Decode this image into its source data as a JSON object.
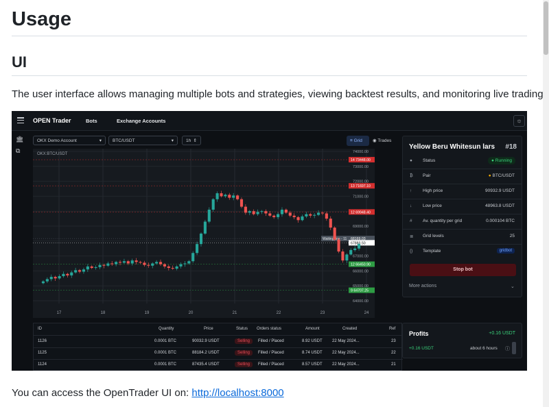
{
  "doc": {
    "heading": "Usage",
    "subheading": "UI",
    "paragraph": "The user interface allows managing multiple bots and strategies, viewing backtest results, and monitoring live trading.",
    "access_prefix": "You can access the OpenTrader UI on: ",
    "access_link": "http://localhost:8000"
  },
  "app": {
    "brand": "OPEN Trader",
    "nav": [
      "Bots",
      "Exchange Accounts"
    ],
    "theme_icon": "sun-icon",
    "toolbar": {
      "account": "OKX Demo Account",
      "pair": "BTC/USDT",
      "timeframe": "1h",
      "view_grid": "Grid",
      "view_trades": "Trades"
    },
    "chart_symbol": "OKX:BTC/USDT",
    "bot": {
      "name": "Yellow Beru Whitesun lars",
      "id": "#18",
      "rows": [
        {
          "icon": "status-icon",
          "label": "Status",
          "value": "Running"
        },
        {
          "icon": "pair-icon",
          "label": "Pair",
          "value": "BTC/USDT"
        },
        {
          "icon": "arrow-up-icon",
          "label": "High price",
          "value": "90932.9 USDT"
        },
        {
          "icon": "arrow-down-icon",
          "label": "Low price",
          "value": "48963.8 USDT"
        },
        {
          "icon": "hash-icon",
          "label": "Av. quantity per grid",
          "value": "0.000104 BTC"
        },
        {
          "icon": "grid-levels-icon",
          "label": "Grid levels",
          "value": "25"
        },
        {
          "icon": "template-icon",
          "label": "Template",
          "value": "gridbot"
        }
      ],
      "stop_label": "Stop bot",
      "more_label": "More actions"
    },
    "profits": {
      "title": "Profits",
      "total": "+0.16 USDT",
      "row_value": "+0.16 USDT",
      "row_time": "about 6 hours"
    },
    "orders": {
      "headers": [
        "ID",
        "Quantity",
        "Price",
        "Status",
        "Orders status",
        "Amount",
        "Created",
        "Ref"
      ],
      "rows": [
        [
          "1126",
          "0.0001 BTC",
          "90032.9 USDT",
          "Selling",
          "Filled / Placed",
          "8.92 USDT",
          "22 May 2024...",
          "23"
        ],
        [
          "1125",
          "0.0001 BTC",
          "88184.2 USDT",
          "Selling",
          "Filled / Placed",
          "8.74 USDT",
          "22 May 2024...",
          "22"
        ],
        [
          "1124",
          "0.0001 BTC",
          "87435.4 USDT",
          "Selling",
          "Filled / Placed",
          "8.57 USDT",
          "22 May 2024...",
          "21"
        ]
      ]
    }
  },
  "chart_data": {
    "type": "candlestick",
    "title": "OKX:BTC/USDT",
    "x_ticks": [
      "17",
      "18",
      "19",
      "20",
      "21",
      "22",
      "23",
      "24"
    ],
    "y_ticks": [
      "74000.00",
      "73000.00",
      "72000.00",
      "71000.00",
      "70000.00",
      "69000.00",
      "68000.00",
      "67000.00",
      "66000.00",
      "65000.00",
      "64000.00"
    ],
    "ylim": [
      64000,
      74000
    ],
    "grid_labels": [
      {
        "index": "14",
        "price": "73448.00",
        "color": "#d32f2f"
      },
      {
        "index": "13",
        "price": "71697.10",
        "color": "#d32f2f"
      },
      {
        "index": "12",
        "price": "69948.40",
        "color": "#d32f2f"
      },
      {
        "index": "",
        "price": "68169.03",
        "color": "#7b8491"
      },
      {
        "index": "",
        "price": "67883.50",
        "color": "#ffffff"
      },
      {
        "index": "12",
        "price": "66450.90",
        "color": "#2e9d44"
      },
      {
        "index": "9",
        "price": "64707.25",
        "color": "#2e9d44"
      }
    ],
    "waiting_label": "Waiting line - 11",
    "close_series": [
      65300,
      65450,
      65600,
      65500,
      65650,
      65800,
      65700,
      65900,
      66050,
      65950,
      66100,
      66300,
      66200,
      66250,
      66400,
      66350,
      66500,
      66450,
      66600,
      66550,
      66650,
      66500,
      66700,
      66600,
      66550,
      66400,
      66350,
      66500,
      66600,
      66450,
      66300,
      66200,
      66150,
      66300,
      66450,
      66500,
      66650,
      67200,
      67800,
      68500,
      69300,
      70100,
      70800,
      71200,
      71000,
      71100,
      70900,
      71050,
      70800,
      70300,
      69900,
      70000,
      69800,
      69950,
      70000,
      69850,
      69700,
      69600,
      69800,
      70100,
      69900,
      69700,
      69600,
      69400,
      69650,
      69800,
      69700,
      69750,
      69900,
      69850,
      69500,
      68900,
      68100,
      67300,
      66700,
      67100,
      67400,
      67500,
      67800
    ]
  }
}
